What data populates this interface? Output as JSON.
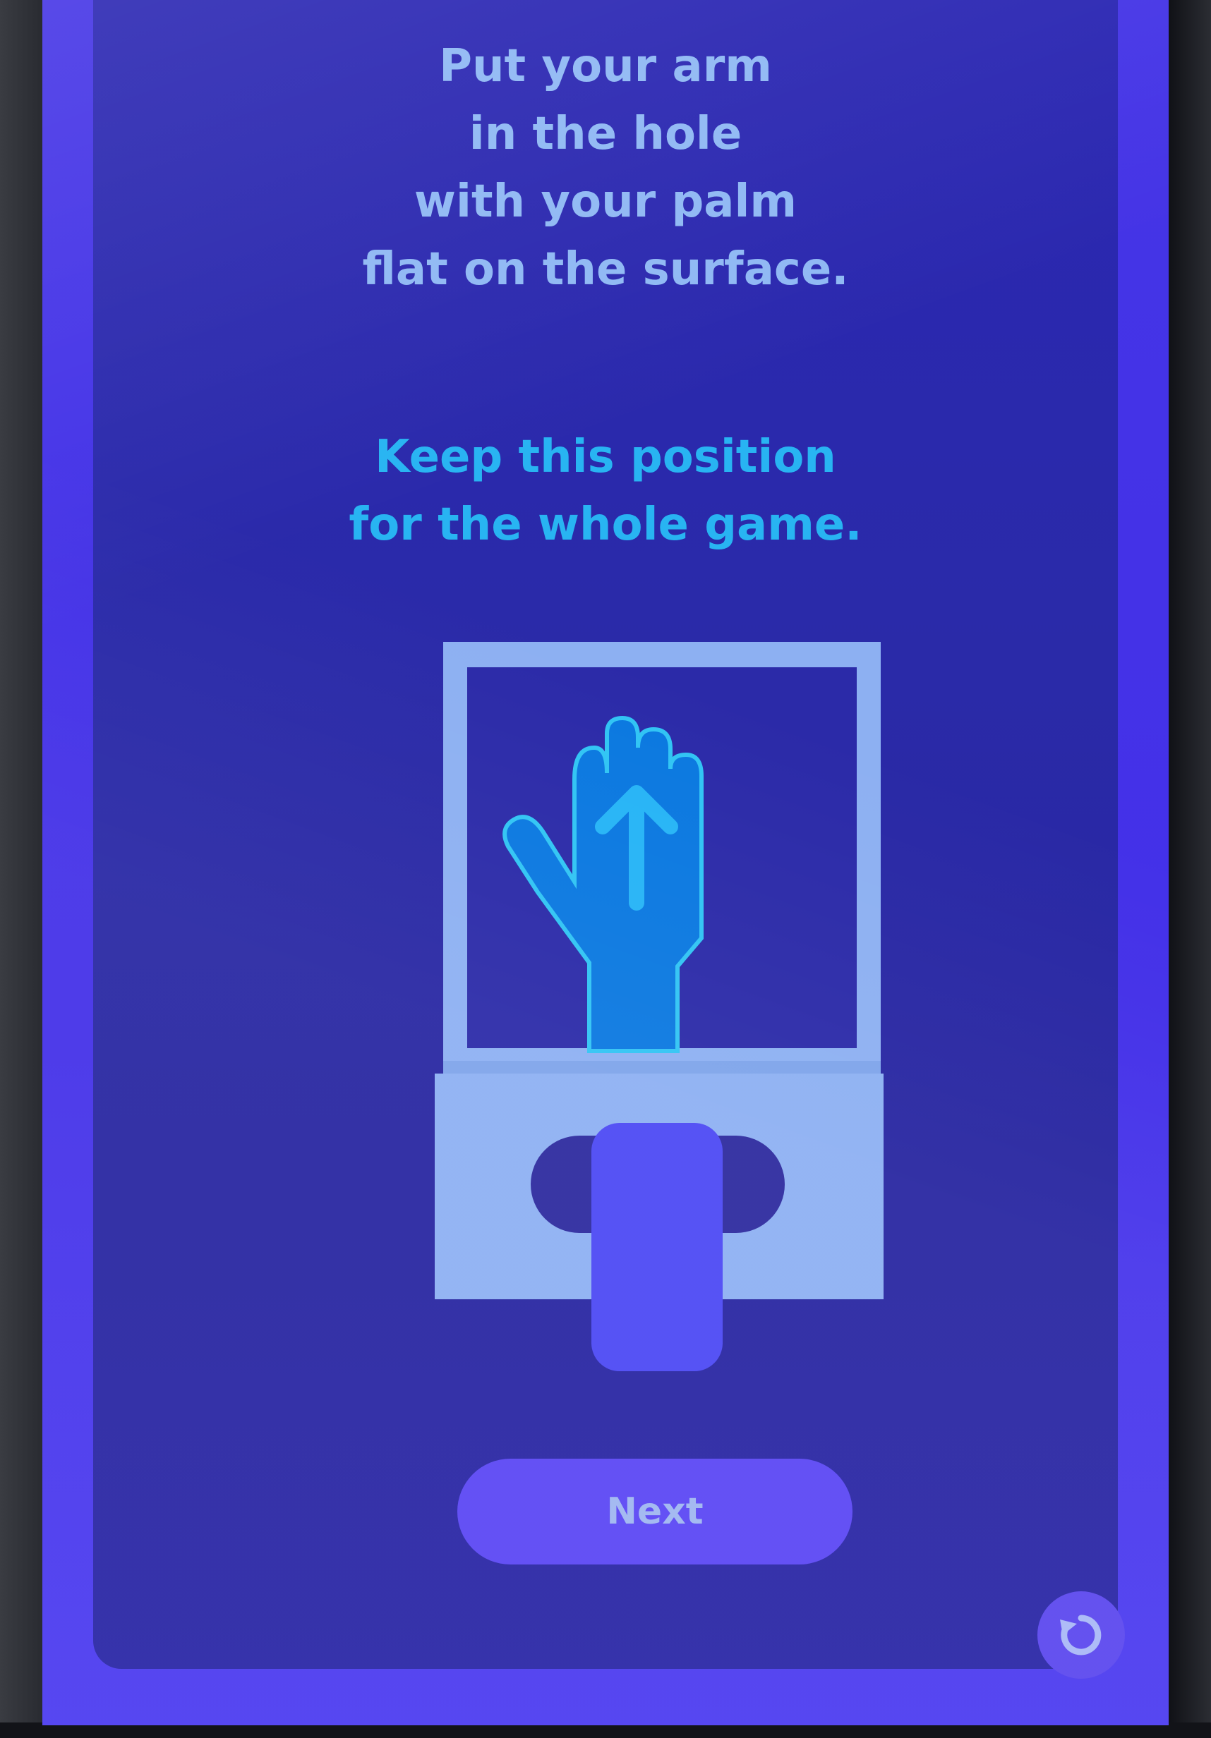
{
  "screen": {
    "instruction_primary": "Put your arm\nin the hole\nwith your palm\nflat on the surface.",
    "instruction_secondary": "Keep this position\nfor the whole game."
  },
  "illustration": {
    "icon": "hand-in-hole-illustration",
    "colors": {
      "frame": "#8db0f2",
      "window": "#2b2aa8",
      "hand": "#0a78e0",
      "hand_outline": "#30c4f4",
      "arm": "#4b48f4",
      "hole": "#2d2a9e"
    }
  },
  "actions": {
    "next_label": "Next",
    "reset_icon": "refresh-icon"
  },
  "theme": {
    "background": "#4535e6",
    "panel": "#2a2aa8",
    "text_primary": "#8fb8f4",
    "text_secondary": "#28b4f2",
    "button": "#5a46f4"
  }
}
